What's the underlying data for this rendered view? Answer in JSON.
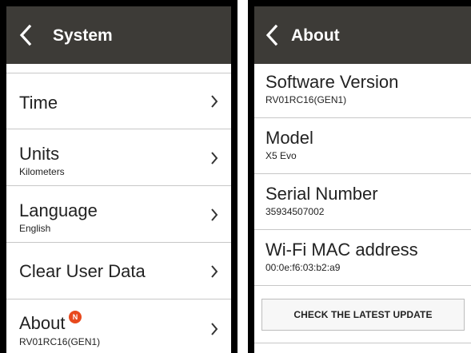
{
  "system_screen": {
    "header": {
      "title": "System"
    },
    "items": [
      {
        "label": "Time",
        "value": ""
      },
      {
        "label": "Units",
        "value": "Kilometers"
      },
      {
        "label": "Language",
        "value": "English"
      },
      {
        "label": "Clear User Data",
        "value": ""
      },
      {
        "label": "About",
        "value": "RV01RC16(GEN1)",
        "badge": "N"
      }
    ]
  },
  "about_screen": {
    "header": {
      "title": "About"
    },
    "items": [
      {
        "label": "Software Version",
        "value": "RV01RC16(GEN1)"
      },
      {
        "label": "Model",
        "value": "X5 Evo"
      },
      {
        "label": "Serial Number",
        "value": "35934507002"
      },
      {
        "label": "Wi-Fi MAC address",
        "value": "00:0e:f6:03:b2:a9"
      }
    ],
    "update_button": "CHECK THE LATEST UPDATE"
  },
  "colors": {
    "header_bg": "#3d3b37",
    "badge": "#e8491d",
    "divider": "#c7c7c7"
  },
  "icons": {
    "back": "chevron-left-icon",
    "row_arrow": "chevron-right-icon",
    "new_badge": "new-badge-icon"
  }
}
